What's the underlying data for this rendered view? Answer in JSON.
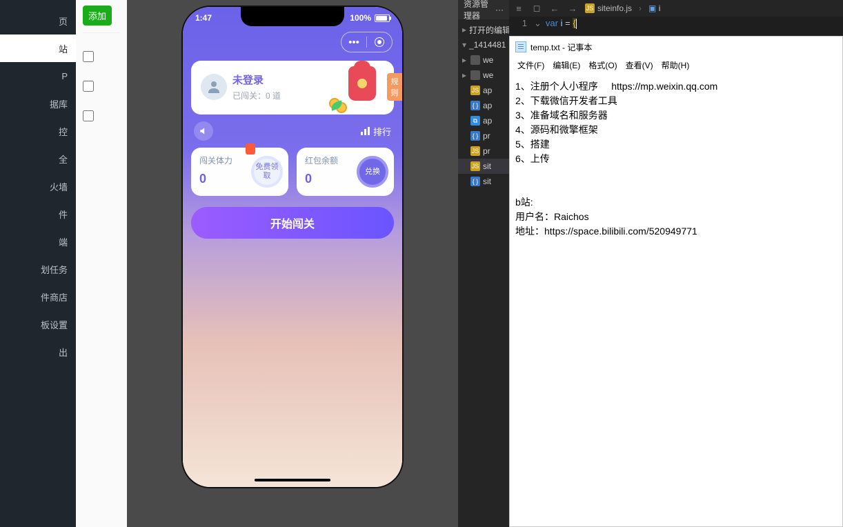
{
  "sidebar": {
    "items": [
      {
        "label": "页",
        "active": false
      },
      {
        "label": "站",
        "active": true
      },
      {
        "label": "P",
        "active": false
      },
      {
        "label": "据库",
        "active": false
      },
      {
        "label": "控",
        "active": false
      },
      {
        "label": "全",
        "active": false
      },
      {
        "label": "火墙",
        "active": false
      },
      {
        "label": "件",
        "active": false
      },
      {
        "label": "端",
        "active": false
      },
      {
        "label": "划任务",
        "active": false
      },
      {
        "label": "件商店",
        "active": false
      },
      {
        "label": "板设置",
        "active": false
      },
      {
        "label": "出",
        "active": false
      }
    ]
  },
  "admin": {
    "add_btn": "添加"
  },
  "phone": {
    "status_time": "1:47",
    "battery_pct": "100%",
    "login_title": "未登录",
    "login_sub_prefix": "已闯关：",
    "login_sub_val": "0 道",
    "rules": "规则",
    "rank": "排行",
    "stat_stamina_label": "闯关体力",
    "stat_stamina_val": "0",
    "pill_free": "免费领取",
    "stat_balance_label": "红包余额",
    "stat_balance_val": "0",
    "pill_redeem": "兑换",
    "start_btn": "开始闯关"
  },
  "explorer": {
    "title": "资源管理器",
    "sections": {
      "open_editors": "打开的编辑器",
      "project": "_1414481"
    },
    "tree": [
      {
        "icon": "fold",
        "label": "we"
      },
      {
        "icon": "fold",
        "label": "we"
      },
      {
        "icon": "js",
        "label": "ap"
      },
      {
        "icon": "json",
        "label": "ap"
      },
      {
        "icon": "html",
        "label": "ap"
      },
      {
        "icon": "json",
        "label": "pr"
      },
      {
        "icon": "js",
        "label": "pr"
      },
      {
        "icon": "js",
        "label": "sit",
        "sel": true
      },
      {
        "icon": "json",
        "label": "sit"
      }
    ]
  },
  "editor": {
    "tab_file": "siteinfo.js",
    "crumb_var": "i",
    "line_no": "1",
    "kw": "var",
    "ident": "i",
    "eq": "=",
    "brace": "{"
  },
  "notepad": {
    "title": "temp.txt - 记事本",
    "menu": {
      "file": "文件(F)",
      "edit": "编辑(E)",
      "format": "格式(O)",
      "view": "查看(V)",
      "help": "帮助(H)"
    },
    "body": "1、注册个人小程序     https://mp.weixin.qq.com\n2、下载微信开发者工具\n3、准备域名和服务器\n4、源码和微擎框架\n5、搭建\n6、上传\n\n\nb站:\n用户名：Raichos\n地址：https://space.bilibili.com/520949771"
  }
}
